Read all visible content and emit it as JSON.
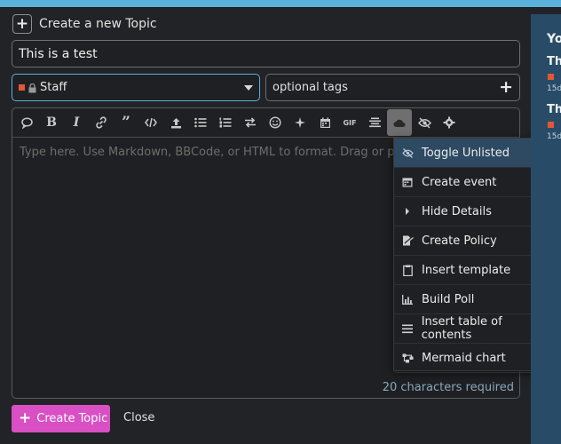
{
  "composer": {
    "header_title": "Create a new Topic",
    "title_value": "This is a test",
    "category": "Staff",
    "tags_placeholder": "optional tags",
    "editor_placeholder": "Type here. Use Markdown, BBCode, or HTML to format. Drag or paste images.",
    "chars_required": "20 characters required",
    "create_label": "Create Topic",
    "close_label": "Close"
  },
  "toolbar": {
    "gif_label": "GIF"
  },
  "dropdown": {
    "items": [
      {
        "label": "Toggle Unlisted",
        "icon": "eye-slash-icon"
      },
      {
        "label": "Create event",
        "icon": "calendar-icon"
      },
      {
        "label": "Hide Details",
        "icon": "caret-right-icon"
      },
      {
        "label": "Create Policy",
        "icon": "file-signature-icon"
      },
      {
        "label": "Insert template",
        "icon": "clipboard-icon"
      },
      {
        "label": "Build Poll",
        "icon": "chart-bar-icon"
      },
      {
        "label": "Insert table of contents",
        "icon": "list-icon"
      },
      {
        "label": "Mermaid chart",
        "icon": "diagram-icon"
      }
    ]
  },
  "side_panel": {
    "heading": "Yo",
    "entry_1": "Thi",
    "entry_1_meta": "15d",
    "entry_2": "Thi",
    "entry_2_meta": "15d"
  },
  "colors": {
    "accent": "#5cb0dc",
    "create_button": "#d94fc4",
    "category": "#e45735",
    "dropdown_selected": "#2d4a62"
  }
}
